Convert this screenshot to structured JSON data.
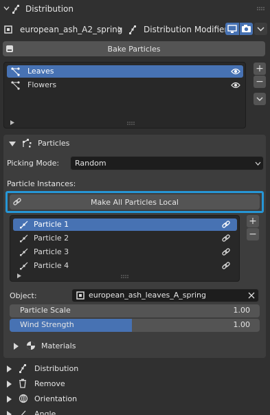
{
  "header": {
    "title": "Distribution",
    "object_name": "european_ash_A2_spring",
    "modifier_name": "Distribution Modifier"
  },
  "bake": {
    "label": "Bake Particles"
  },
  "systems": {
    "items": [
      {
        "label": "Leaves",
        "selected": true
      },
      {
        "label": "Flowers",
        "selected": false
      }
    ],
    "add_label": "+",
    "remove_label": "−"
  },
  "particles_panel": {
    "title": "Particles",
    "picking_mode_label": "Picking Mode:",
    "picking_mode_value": "Random",
    "instances_label": "Particle Instances:",
    "make_local_label": "Make All Particles Local",
    "instances": [
      {
        "label": "Particle 1",
        "selected": true
      },
      {
        "label": "Particle 2",
        "selected": false
      },
      {
        "label": "Particle 3",
        "selected": false
      },
      {
        "label": "Particle 4",
        "selected": false
      }
    ],
    "object_label": "Object:",
    "object_value": "european_ash_leaves_A_spring",
    "scale_label": "Particle Scale",
    "scale_value": "1.00",
    "wind_label": "Wind Strength",
    "wind_value": "1.00",
    "wind_fill_fraction": 0.49,
    "materials_label": "Materials"
  },
  "sections": [
    {
      "label": "Distribution",
      "icon": "distribution-icon"
    },
    {
      "label": "Remove",
      "icon": "trash-icon"
    },
    {
      "label": "Orientation",
      "icon": "orientation-icon"
    },
    {
      "label": "Angle",
      "icon": "angle-icon"
    }
  ],
  "colors": {
    "background": "#303030",
    "selection": "#4772b3",
    "highlight": "#2696d6"
  }
}
